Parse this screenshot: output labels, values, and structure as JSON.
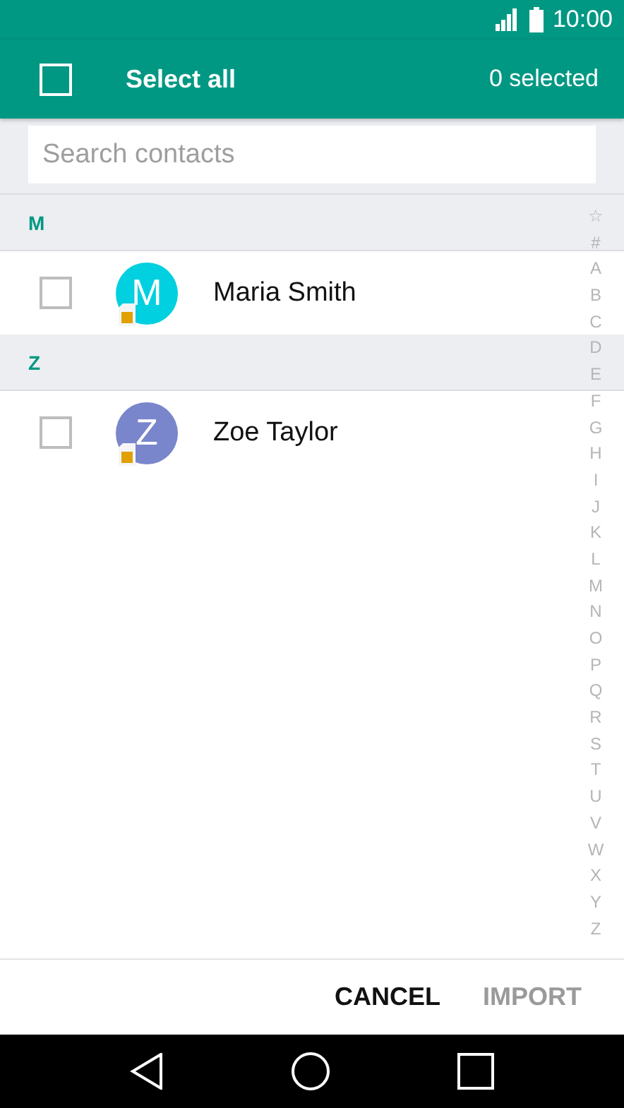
{
  "status_bar": {
    "time": "10:00"
  },
  "toolbar": {
    "select_all_label": "Select all",
    "select_all_checked": false,
    "selected_count": "0 selected"
  },
  "search": {
    "placeholder": "Search contacts"
  },
  "sections": [
    {
      "letter": "M",
      "contacts": [
        {
          "name": "Maria Smith",
          "initial": "M",
          "color": "#00d0e0",
          "checked": false
        }
      ]
    },
    {
      "letter": "Z",
      "contacts": [
        {
          "name": "Zoe Taylor",
          "initial": "Z",
          "color": "#7986cb",
          "checked": false
        }
      ]
    }
  ],
  "index": [
    "☆",
    "#",
    "A",
    "B",
    "C",
    "D",
    "E",
    "F",
    "G",
    "H",
    "I",
    "J",
    "K",
    "L",
    "M",
    "N",
    "O",
    "P",
    "Q",
    "R",
    "S",
    "T",
    "U",
    "V",
    "W",
    "X",
    "Y",
    "Z"
  ],
  "buttons": [
    {
      "label": "CANCEL",
      "disabled": false
    },
    {
      "label": "IMPORT",
      "disabled": true
    }
  ]
}
